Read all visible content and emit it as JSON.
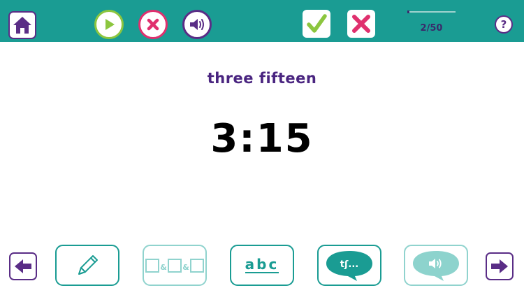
{
  "toolbar": {
    "home_icon": "home-icon",
    "play_icon": "play-icon",
    "stop_icon": "close-icon",
    "sound_icon": "speaker-icon",
    "check_icon": "check-icon",
    "cross_icon": "cross-icon",
    "help_label": "?"
  },
  "progress": {
    "label": "2/50",
    "current": 2,
    "total": 50
  },
  "card": {
    "word": "three fifteen",
    "time": "3:15"
  },
  "bottom": {
    "abc_label": "abc",
    "phonetic_label": "tʃ..."
  },
  "colors": {
    "teal": "#1a9c93",
    "purple": "#5a2d86",
    "green": "#8cc63f",
    "pink": "#e0306e"
  }
}
